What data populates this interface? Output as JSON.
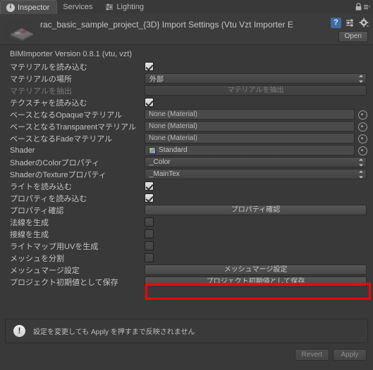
{
  "tabs": [
    {
      "label": "Inspector",
      "icon": "info-icon",
      "active": true
    },
    {
      "label": "Services",
      "icon": "",
      "active": false
    },
    {
      "label": "Lighting",
      "icon": "lighting-icon",
      "active": false
    }
  ],
  "header": {
    "title": "rac_basic_sample_project_{3D} Import Settings (Vtu Vzt Importer E",
    "open_label": "Open",
    "help_glyph": "?"
  },
  "body": {
    "version_line": "BIMImporter Version 0.8.1 (vtu, vzt)",
    "rows": [
      {
        "label": "マテリアルを読み込む",
        "type": "checkbox",
        "value": true
      },
      {
        "label": "マテリアルの場所",
        "type": "popup",
        "value": "外部"
      },
      {
        "label": "マテリアルを抽出",
        "type": "button",
        "value": "マテリアルを抽出",
        "disabled": true
      },
      {
        "label": "テクスチャを読み込む",
        "type": "checkbox",
        "value": true
      },
      {
        "label": "ベースとなるOpaqueマテリアル",
        "type": "object",
        "value": "None (Material)"
      },
      {
        "label": "ベースとなるTransparentマテリアル",
        "type": "object",
        "value": "None (Material)"
      },
      {
        "label": "ベースとなるFadeマテリアル",
        "type": "object",
        "value": "None (Material)"
      },
      {
        "label": "Shader",
        "type": "object-shader",
        "value": "Standard"
      },
      {
        "label": "ShaderのColorプロパティ",
        "type": "popup",
        "value": "_Color"
      },
      {
        "label": "ShaderのTextureプロパティ",
        "type": "popup",
        "value": "_MainTex"
      },
      {
        "label": "ライトを読み込む",
        "type": "checkbox",
        "value": true
      },
      {
        "label": "プロパティを読み込む",
        "type": "checkbox",
        "value": true
      },
      {
        "label": "プロパティ確認",
        "type": "button",
        "value": "プロパティ確認",
        "disabled": false
      },
      {
        "label": "法線を生成",
        "type": "checkbox",
        "value": false
      },
      {
        "label": "接線を生成",
        "type": "checkbox",
        "value": false
      },
      {
        "label": "ライトマップ用UVを生成",
        "type": "checkbox",
        "value": false
      },
      {
        "label": "メッシュを分割",
        "type": "checkbox",
        "value": false
      },
      {
        "label": "メッシュマージ設定",
        "type": "button",
        "value": "メッシュマージ設定",
        "disabled": false,
        "highlighted": true
      },
      {
        "label": "プロジェクト初期値として保存",
        "type": "button",
        "value": "プロジェクト初期値として保存",
        "disabled": false
      }
    ]
  },
  "info": {
    "message": "設定を変更しても Apply を押すまで反映されません"
  },
  "footer": {
    "revert_label": "Revert",
    "apply_label": "Apply"
  },
  "colors": {
    "window_bg": "#393939",
    "header_bg": "#3c3c3c",
    "tab_active_bg": "#4c4c4c",
    "highlight": "#ff0000",
    "text": "#c4c4c4"
  }
}
